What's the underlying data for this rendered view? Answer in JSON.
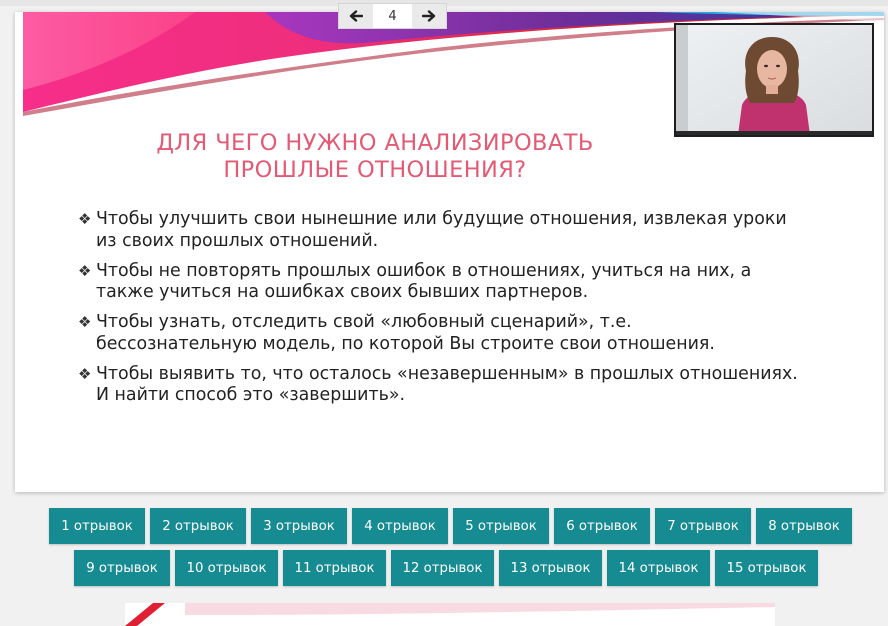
{
  "pager": {
    "page": "4",
    "prev_icon": "arrow-left-icon",
    "next_icon": "arrow-right-icon"
  },
  "slide": {
    "title_lines": [
      "ДЛЯ ЧЕГО НУЖНО АНАЛИЗИРОВАТЬ",
      "ПРОШЛЫЕ ОТНОШЕНИЯ?"
    ],
    "bullet_mark": "❖",
    "bullets": [
      {
        "lines": [
          "Чтобы улучшить свои нынешние или будущие отношения, извлекая уроки",
          "из своих прошлых отношений."
        ]
      },
      {
        "lines": [
          "Чтобы не повторять прошлых ошибок в отношениях, учиться на них, а",
          "также учиться на ошибках своих бывших партнеров."
        ]
      },
      {
        "lines": [
          "Чтобы узнать, отследить свой «любовный сценарий», т.е.",
          "бессознательную модель, по которой Вы строите свои отношения."
        ]
      },
      {
        "lines": [
          "Чтобы выявить то, что осталось «незавершенным» в прошлых отношениях.",
          "И найти способ это «завершить»."
        ]
      }
    ]
  },
  "chapters": {
    "row1": [
      "1 отрывок",
      "2 отрывок",
      "3 отрывок",
      "4 отрывок",
      "5 отрывок",
      "6 отрывок",
      "7 отрывок",
      "8 отрывок"
    ],
    "row2": [
      "9 отрывок",
      "10 отрывок",
      "11 отрывок",
      "12 отрывок",
      "13 отрывок",
      "14 отрывок",
      "15 отрывок"
    ]
  },
  "colors": {
    "accent": "#168b91",
    "title": "#e35a74"
  }
}
